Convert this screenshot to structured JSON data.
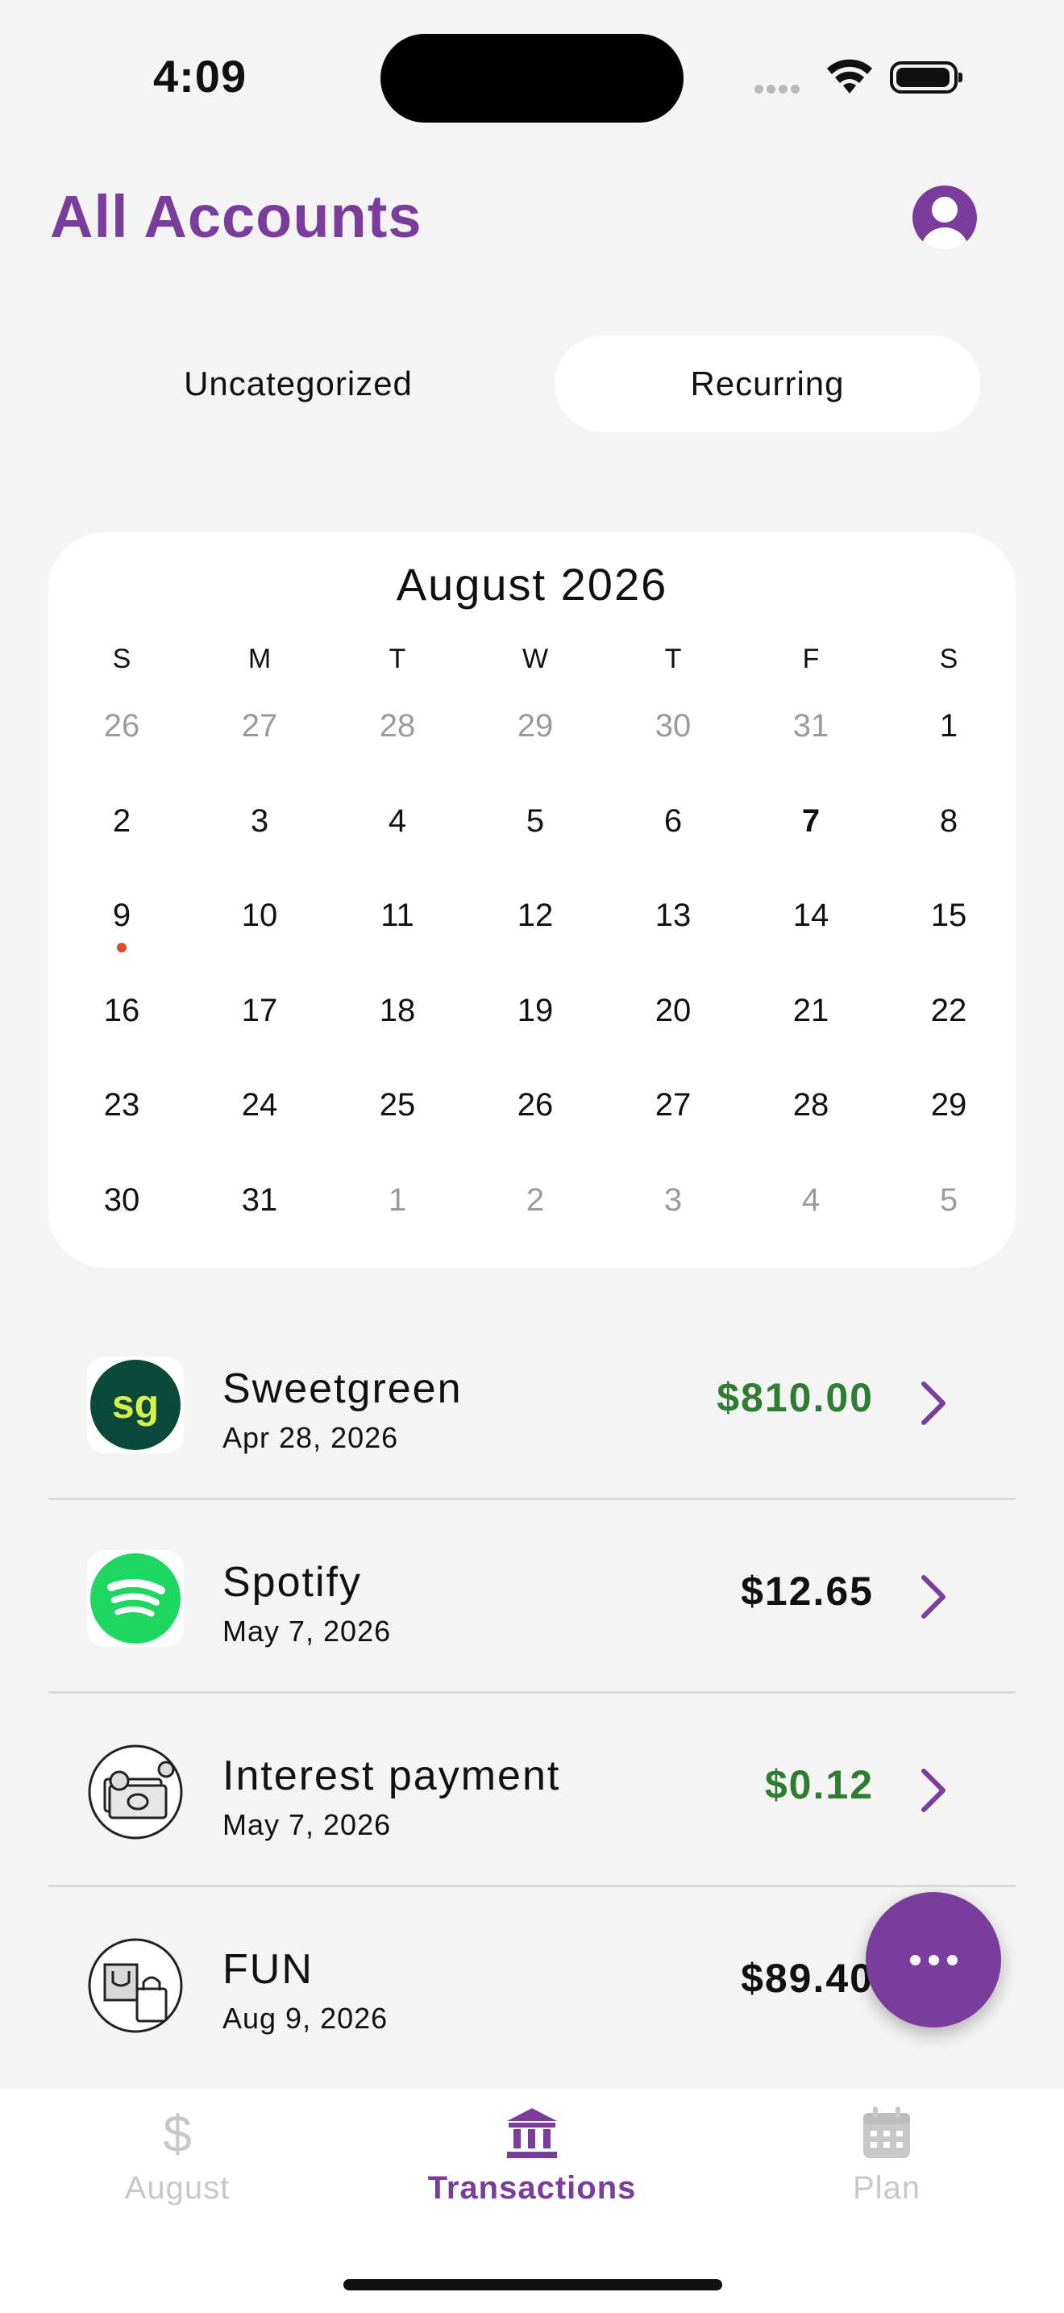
{
  "status": {
    "time": "4:09"
  },
  "header": {
    "title": "All Accounts"
  },
  "segments": {
    "left": "Uncategorized",
    "right": "Recurring",
    "selected": "Recurring"
  },
  "calendar": {
    "title": "August 2026",
    "weekdays": [
      "S",
      "M",
      "T",
      "W",
      "T",
      "F",
      "S"
    ],
    "weeks": [
      [
        "26",
        "27",
        "28",
        "29",
        "30",
        "31",
        "1"
      ],
      [
        "2",
        "3",
        "4",
        "5",
        "6",
        "7",
        "8"
      ],
      [
        "9",
        "10",
        "11",
        "12",
        "13",
        "14",
        "15"
      ],
      [
        "16",
        "17",
        "18",
        "19",
        "20",
        "21",
        "22"
      ],
      [
        "23",
        "24",
        "25",
        "26",
        "27",
        "28",
        "29"
      ],
      [
        "30",
        "31",
        "1",
        "2",
        "3",
        "4",
        "5"
      ]
    ],
    "muted": [
      [
        0,
        0
      ],
      [
        0,
        1
      ],
      [
        0,
        2
      ],
      [
        0,
        3
      ],
      [
        0,
        4
      ],
      [
        0,
        5
      ],
      [
        5,
        2
      ],
      [
        5,
        3
      ],
      [
        5,
        4
      ],
      [
        5,
        5
      ],
      [
        5,
        6
      ]
    ],
    "today": [
      1,
      5
    ],
    "event_dot": [
      2,
      0
    ],
    "dot_color": "#e04a2f"
  },
  "transactions": [
    {
      "name": "Sweetgreen",
      "date": "Apr 28, 2026",
      "amount": "$810.00",
      "positive": true,
      "icon": "sweetgreen-logo",
      "logo_text": "sg"
    },
    {
      "name": "Spotify",
      "date": "May 7, 2026",
      "amount": "$12.65",
      "positive": false,
      "icon": "spotify-logo"
    },
    {
      "name": "Interest payment",
      "date": "May 7, 2026",
      "amount": "$0.12",
      "positive": true,
      "icon": "money-icon"
    },
    {
      "name": "FUN",
      "date": "Aug 9, 2026",
      "amount": "$89.40",
      "positive": false,
      "icon": "shopping-bags-icon"
    }
  ],
  "tabs": [
    {
      "label": "August",
      "icon": "dollar-icon",
      "active": false
    },
    {
      "label": "Transactions",
      "icon": "bank-icon",
      "active": true
    },
    {
      "label": "Plan",
      "icon": "calendar-icon",
      "active": false
    }
  ],
  "colors": {
    "accent": "#7a3d9b",
    "positive": "#2f7d32",
    "sweetgreen_bg": "#0b4a3a",
    "sweetgreen_text": "#d8f04a",
    "spotify": "#1ed760"
  }
}
